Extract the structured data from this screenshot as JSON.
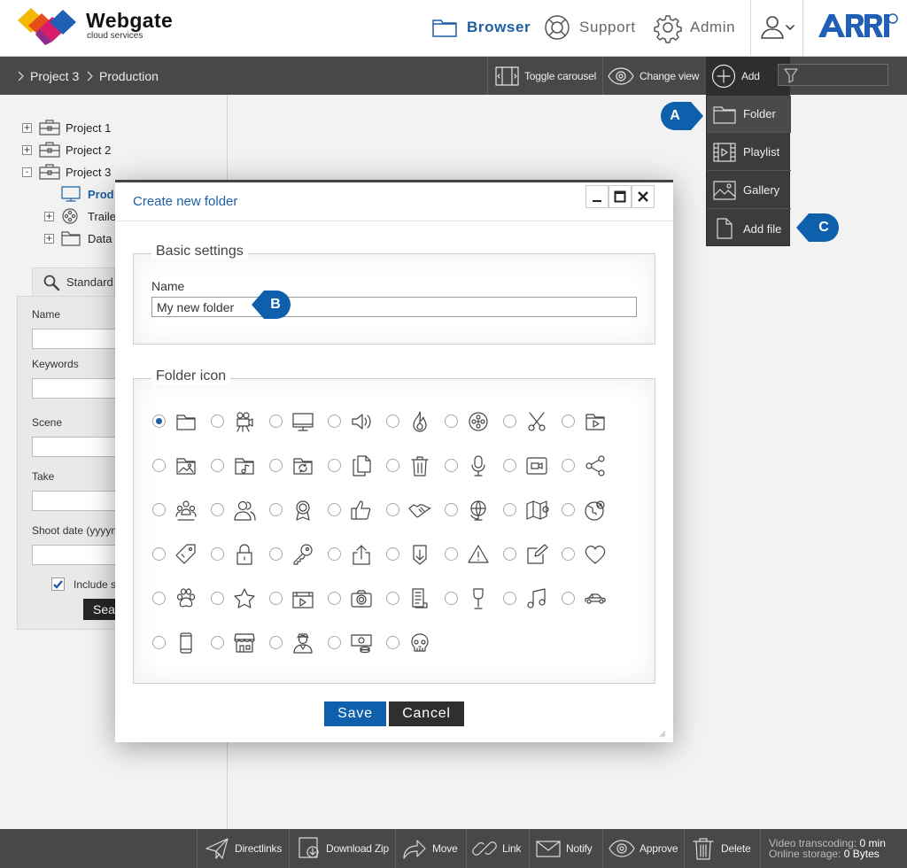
{
  "brand": {
    "name": "Webgate",
    "tagline": "cloud services"
  },
  "nav": {
    "browser": "Browser",
    "support": "Support",
    "admin": "Admin"
  },
  "breadcrumb": [
    "Project 3",
    "Production"
  ],
  "toolbar": {
    "toggle_carousel": "Toggle carousel",
    "change_view": "Change view",
    "add": "Add"
  },
  "add_menu": [
    "Folder",
    "Playlist",
    "Gallery",
    "Add file"
  ],
  "callouts": {
    "a": "A",
    "b": "B",
    "c": "C"
  },
  "tree": {
    "project1": "Project 1",
    "project2": "Project 2",
    "project3": "Project 3",
    "production": "Prod",
    "trailer": "Traile",
    "data": "Data"
  },
  "search": {
    "tab": "Standard",
    "name": "Name",
    "keywords": "Keywords",
    "scene": "Scene",
    "take": "Take",
    "shoot_date": "Shoot date (yyyym",
    "include": "Include s",
    "include_checked": true,
    "button": "Sea"
  },
  "dialog": {
    "title": "Create new folder",
    "basic_settings": "Basic settings",
    "name_label": "Name",
    "name_value": "My new folder",
    "folder_icon": "Folder icon",
    "selected_icon": "folder-icon",
    "icons": [
      "folder-icon",
      "movie-camera-icon",
      "monitor-icon",
      "speaker-icon",
      "flame-icon",
      "film-reel-icon",
      "scissors-icon",
      "video-folder-icon",
      "image-folder-icon",
      "music-folder-icon",
      "sync-folder-icon",
      "copy-documents-icon",
      "trash-icon",
      "microphone-icon",
      "video-call-icon",
      "share-icon",
      "user-group-icon",
      "users-icon",
      "award-ribbon-icon",
      "thumbs-up-icon",
      "handshake-icon",
      "globe-icon",
      "map-pin-icon",
      "world-location-icon",
      "tag-icon",
      "lock-icon",
      "key-icon",
      "upload-icon",
      "download-icon",
      "warning-icon",
      "edit-icon",
      "heart-icon",
      "paw-icon",
      "star-icon",
      "clapper-icon",
      "camera-icon",
      "document-icon",
      "wine-glass-icon",
      "music-note-icon",
      "car-icon",
      "smartphone-icon",
      "shop-icon",
      "person-icon",
      "money-icon",
      "skull-icon"
    ],
    "save": "Save",
    "cancel": "Cancel"
  },
  "bottom": {
    "directlinks": "Directlinks",
    "download_zip": "Download Zip",
    "move": "Move",
    "link": "Link",
    "notify": "Notify",
    "approve": "Approve",
    "delete": "Delete",
    "transcoding_label": "Video transcoding:",
    "transcoding_value": "0 min",
    "storage_label": "Online storage:",
    "storage_value": "0 Bytes"
  },
  "colors": {
    "accent": "#1d5fa3",
    "dark_bar": "#484848",
    "save_button": "#0e5fac",
    "callout": "#0e5fac"
  }
}
